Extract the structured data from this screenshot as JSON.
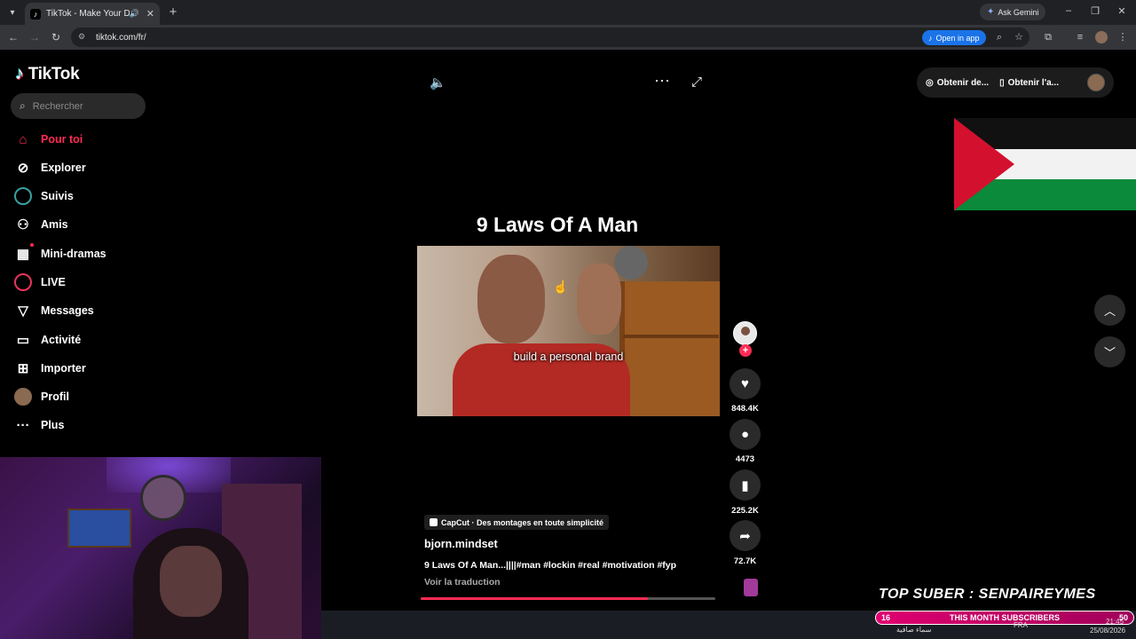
{
  "browser": {
    "tab_title": "TikTok - Make Your Day",
    "url": "tiktok.com/fr/",
    "ask_gemini": "Ask Gemini",
    "open_in_app": "Open in app"
  },
  "sidebar": {
    "brand": "TikTok",
    "search_placeholder": "Rechercher",
    "items": [
      {
        "label": "Pour toi",
        "icon": "home-icon"
      },
      {
        "label": "Explorer",
        "icon": "compass-icon"
      },
      {
        "label": "Suivis",
        "icon": "following-icon"
      },
      {
        "label": "Amis",
        "icon": "friends-icon"
      },
      {
        "label": "Mini-dramas",
        "icon": "film-icon"
      },
      {
        "label": "LIVE",
        "icon": "live-icon"
      },
      {
        "label": "Messages",
        "icon": "paper-plane-icon"
      },
      {
        "label": "Activité",
        "icon": "message-square-icon"
      },
      {
        "label": "Importer",
        "icon": "plus-square-icon"
      },
      {
        "label": "Profil",
        "icon": "avatar-icon"
      },
      {
        "label": "Plus",
        "icon": "ellipsis-icon"
      }
    ]
  },
  "video": {
    "title": "9 Laws Of A Man",
    "caption": "build a personal brand",
    "capcut_label": "CapCut · Des montages en toute simplicité",
    "author": "bjorn.mindset",
    "description": "9 Laws Of A Man...||||#man #lockin #real #motivation #fyp",
    "translate": "Voir la traduction",
    "progress": 0.77
  },
  "actions": {
    "likes": "848.4K",
    "comments": "4473",
    "saves": "225.2K",
    "shares": "72.7K"
  },
  "header_right": {
    "get_coins": "Obtenir de...",
    "get_app": "Obtenir l'a..."
  },
  "overlay": {
    "top_suber": "TOP SUBER : SENPAIREYMES",
    "sub_left": "16",
    "sub_label": "THIS MONTH SUBSCRIBERS",
    "sub_right": "50",
    "weather": "سماء صافية",
    "lang": "FRA",
    "time": "21:45",
    "date": "25/08/2026"
  },
  "colors": {
    "accent": "#fe2c55",
    "background": "#000000",
    "chrome_dark": "#202124",
    "chrome_mid": "#35363a"
  }
}
